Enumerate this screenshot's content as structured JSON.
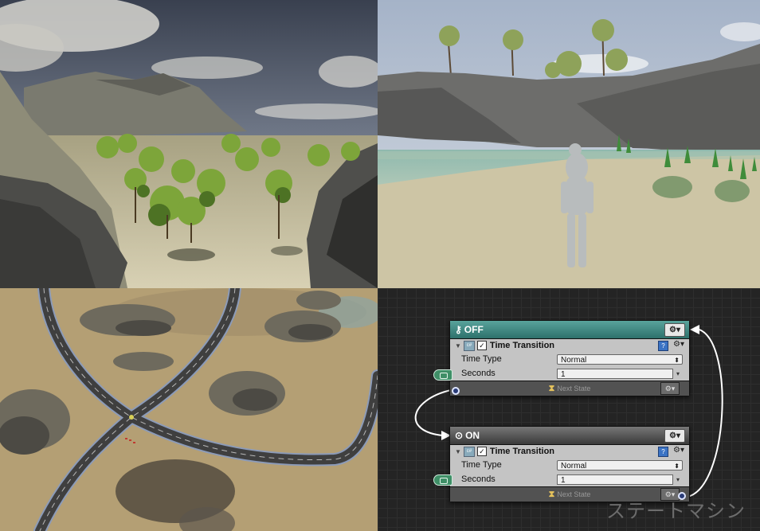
{
  "nodes": {
    "off": {
      "title": "OFF",
      "action": "Time Transition",
      "time_type_label": "Time Type",
      "time_type_value": "Normal",
      "seconds_label": "Seconds",
      "seconds_value": "1",
      "footer": "Next State"
    },
    "on": {
      "title": "ON",
      "action": "Time Transition",
      "time_type_label": "Time Type",
      "time_type_value": "Normal",
      "seconds_label": "Seconds",
      "seconds_value": "1",
      "footer": "Next State"
    }
  },
  "watermark": "ステートマシン",
  "colors": {
    "off_header": "#2d716b",
    "on_header": "#3a3a3a",
    "node_body": "#c4c4c4",
    "graph_bg": "#242424"
  }
}
